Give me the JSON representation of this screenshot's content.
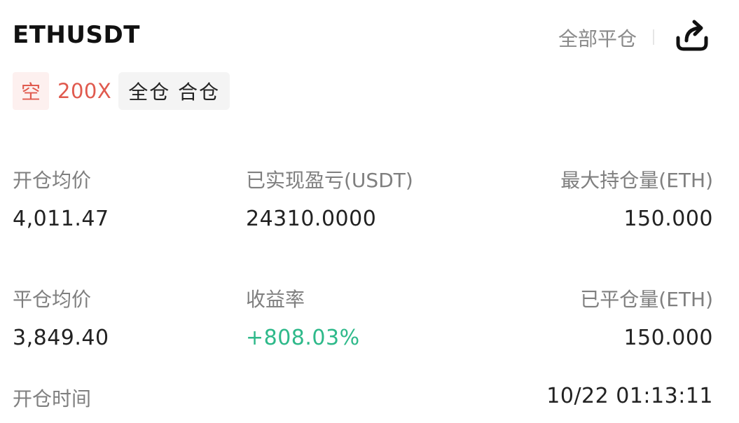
{
  "header": {
    "symbol": "ETHUSDT",
    "close_all_label": "全部平仓",
    "share_icon": "share-icon"
  },
  "tags": {
    "side": "空",
    "leverage": "200X",
    "mode": "全仓 合仓"
  },
  "stats": {
    "open_avg_price_label": "开仓均价",
    "open_avg_price_value": "4,011.47",
    "realized_pnl_label": "已实现盈亏(USDT)",
    "realized_pnl_value": "24310.0000",
    "max_position_label": "最大持仓量(ETH)",
    "max_position_value": "150.000",
    "close_avg_price_label": "平仓均价",
    "close_avg_price_value": "3,849.40",
    "roi_label": "收益率",
    "roi_value": "+808.03%",
    "closed_position_label": "已平仓量(ETH)",
    "closed_position_value": "150.000",
    "open_time_label": "开仓时间",
    "open_time_value": "10/22 01:13:11"
  },
  "colors": {
    "short_red": "#e05a4e",
    "profit_green": "#2eb98a",
    "label_gray": "#7f7f7f"
  }
}
